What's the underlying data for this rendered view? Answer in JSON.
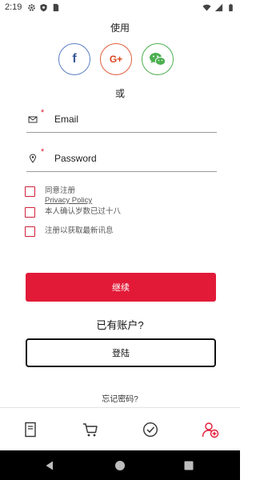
{
  "status_bar": {
    "time": "2:19",
    "left_icons": [
      "gear-icon",
      "shield-icon",
      "sim-card-icon"
    ],
    "right_icons": [
      "wifi-icon",
      "signal-icon",
      "battery-icon"
    ]
  },
  "social": {
    "heading": "使用",
    "buttons": [
      {
        "name": "facebook",
        "label": "f",
        "color": "#3b5998"
      },
      {
        "name": "google-plus",
        "label": "G+",
        "color": "#d9441c"
      },
      {
        "name": "wechat",
        "icon": "wechat-icon",
        "color": "#4caf50"
      }
    ]
  },
  "or_label": "或",
  "form": {
    "email": {
      "placeholder": "Email",
      "value": "",
      "required_mark": "*",
      "icon": "mail-icon"
    },
    "password": {
      "placeholder": "Password",
      "value": "",
      "required_mark": "*",
      "icon": "location-pin-icon"
    }
  },
  "checkboxes": [
    {
      "label": "同意注册",
      "link": "Privacy Policy",
      "checked": false
    },
    {
      "label": "本人确认岁数已过十八",
      "checked": false
    },
    {
      "label": "注册以获取最新讯息",
      "checked": false
    }
  ],
  "continue_label": "继续",
  "have_account_label": "已有账户?",
  "login_label": "登陆",
  "forgot_password_label": "忘记密码?",
  "bottom_nav": {
    "items": [
      {
        "name": "document",
        "icon": "document-icon",
        "active": false
      },
      {
        "name": "cart",
        "icon": "cart-icon",
        "active": false
      },
      {
        "name": "check",
        "icon": "check-circle-icon",
        "active": false
      },
      {
        "name": "account",
        "icon": "add-user-icon",
        "active": true
      }
    ]
  },
  "system_nav": [
    "back-icon",
    "home-icon",
    "recents-icon"
  ],
  "colors": {
    "accent": "#e21a38",
    "facebook": "#3b5998",
    "google": "#d9441c",
    "wechat": "#4caf50"
  }
}
